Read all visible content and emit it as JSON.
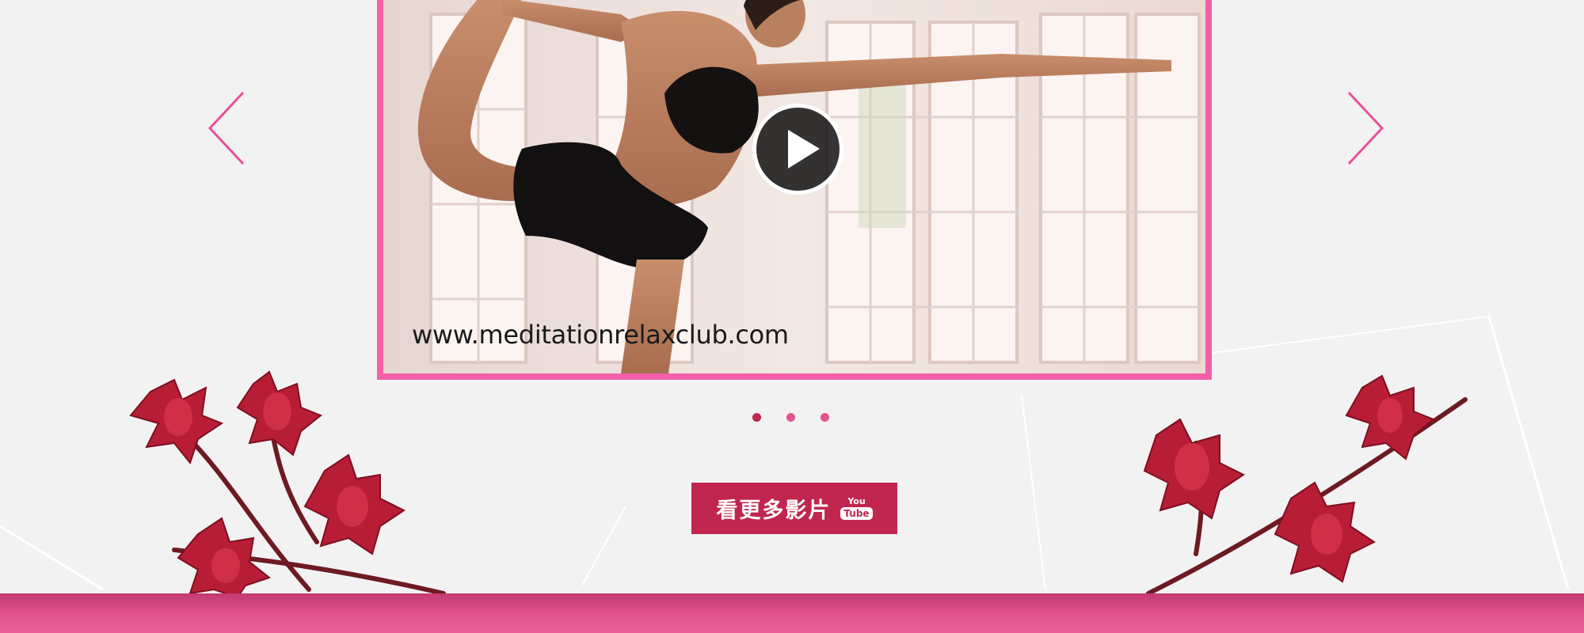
{
  "carousel": {
    "video": {
      "watermark": "www.meditationrelaxclub.com",
      "frame_color": "#f25fa8"
    },
    "icons": {
      "prev": "chevron-left-icon",
      "next": "chevron-right-icon",
      "play": "play-icon"
    },
    "arrow_color": "#ec4e9a",
    "dots": [
      {
        "active": true,
        "color": "#c0264e"
      },
      {
        "active": false,
        "color": "#e0558e"
      },
      {
        "active": false,
        "color": "#e0558e"
      }
    ]
  },
  "cta": {
    "label": "看更多影片",
    "icon": "youtube-icon",
    "youtube_top": "You",
    "youtube_bottom": "Tube",
    "color": "#c0264e"
  },
  "footer": {
    "color": "#e0558e"
  }
}
